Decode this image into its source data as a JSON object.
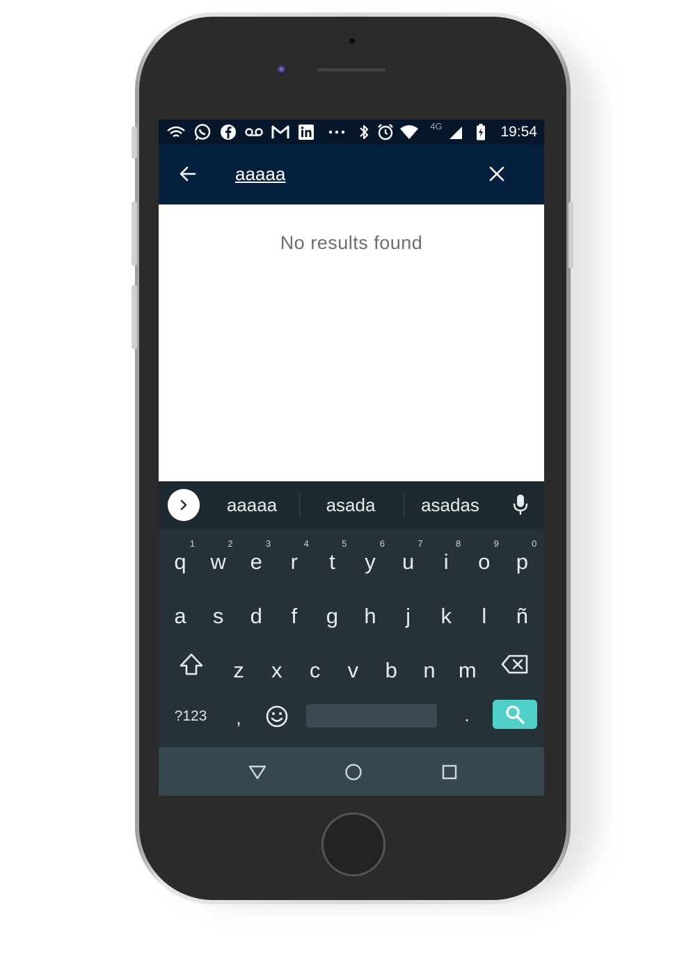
{
  "status_bar": {
    "time": "19:54",
    "network_type": "4G",
    "icons": [
      "wifi-calling-icon",
      "whatsapp-icon",
      "facebook-icon",
      "voicemail-icon",
      "gmail-icon",
      "linkedin-icon",
      "more-notifications-icon",
      "bluetooth-icon",
      "alarm-icon",
      "wifi-icon",
      "signal-icon",
      "battery-charging-icon"
    ]
  },
  "search": {
    "query": "aaaaa",
    "back_icon": "arrow-back-icon",
    "clear_icon": "close-icon"
  },
  "results": {
    "empty_message": "No results found"
  },
  "keyboard": {
    "suggestions": [
      "aaaaa",
      "asada",
      "asadas"
    ],
    "row1": [
      {
        "key": "q",
        "hint": "1"
      },
      {
        "key": "w",
        "hint": "2"
      },
      {
        "key": "e",
        "hint": "3"
      },
      {
        "key": "r",
        "hint": "4"
      },
      {
        "key": "t",
        "hint": "5"
      },
      {
        "key": "y",
        "hint": "6"
      },
      {
        "key": "u",
        "hint": "7"
      },
      {
        "key": "i",
        "hint": "8"
      },
      {
        "key": "o",
        "hint": "9"
      },
      {
        "key": "p",
        "hint": "0"
      }
    ],
    "row2": [
      "a",
      "s",
      "d",
      "f",
      "g",
      "h",
      "j",
      "k",
      "l",
      "ñ"
    ],
    "row3": [
      "z",
      "x",
      "c",
      "v",
      "b",
      "n",
      "m"
    ],
    "symbols_label": "?123",
    "comma": ",",
    "period": ".",
    "accent_color": "#4fcfc8"
  },
  "colors": {
    "status_bar_bg": "#06172c",
    "app_bar_bg": "#06213f",
    "keyboard_bg": "#263238",
    "nav_bar_bg": "#37474f"
  }
}
